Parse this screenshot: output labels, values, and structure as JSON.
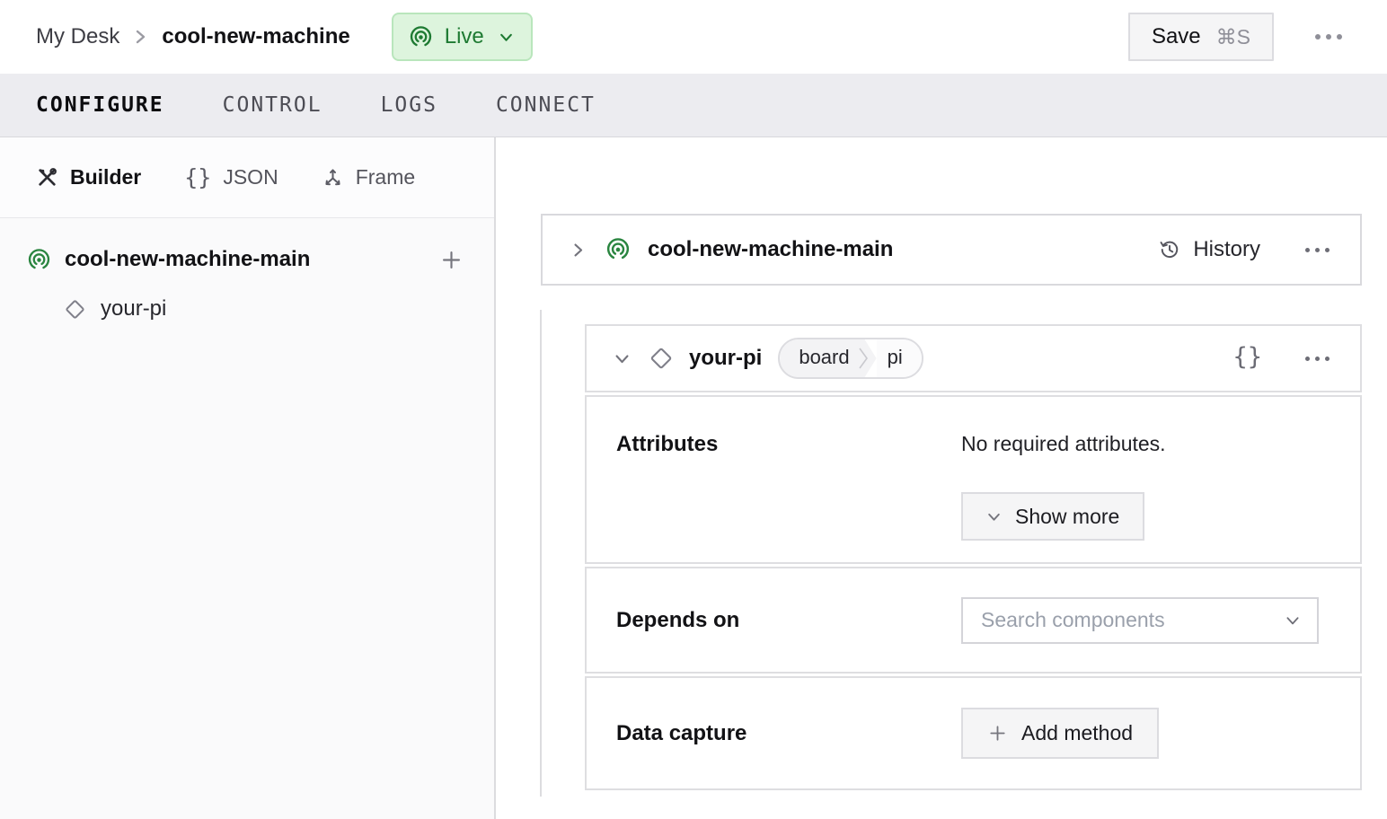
{
  "header": {
    "breadcrumb": {
      "parent": "My Desk",
      "current": "cool-new-machine"
    },
    "live": {
      "label": "Live"
    },
    "save": {
      "label": "Save",
      "shortcut": "⌘S"
    }
  },
  "nav_tabs": [
    {
      "label": "CONFIGURE",
      "active": true
    },
    {
      "label": "CONTROL",
      "active": false
    },
    {
      "label": "LOGS",
      "active": false
    },
    {
      "label": "CONNECT",
      "active": false
    }
  ],
  "sidebar": {
    "views": [
      {
        "label": "Builder",
        "icon": "tools-icon",
        "active": true
      },
      {
        "label": "JSON",
        "icon": "braces-icon",
        "active": false
      },
      {
        "label": "Frame",
        "icon": "axes-icon",
        "active": false
      }
    ],
    "tree": {
      "machine": "cool-new-machine-main",
      "component": "your-pi"
    }
  },
  "main": {
    "machine_card": {
      "title": "cool-new-machine-main",
      "history": "History"
    },
    "component_card": {
      "title": "your-pi",
      "badge": {
        "type": "board",
        "model": "pi"
      },
      "attributes": {
        "label": "Attributes",
        "empty": "No required attributes.",
        "show_more": "Show more"
      },
      "depends_on": {
        "label": "Depends on",
        "placeholder": "Search components"
      },
      "data_capture": {
        "label": "Data capture",
        "add_method": "Add method"
      }
    }
  },
  "colors": {
    "accent_green": "#2a8540",
    "live_bg": "#ddf4dd",
    "live_border": "#b9e6bc",
    "live_text": "#1e7a32",
    "tabbar_bg": "#ececf0",
    "border": "#dcdcdf"
  }
}
